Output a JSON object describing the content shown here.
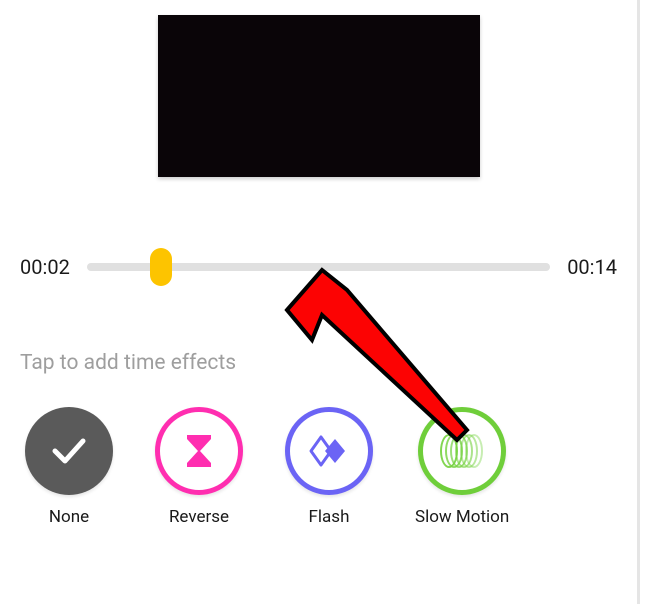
{
  "timeline": {
    "current_time": "00:02",
    "total_time": "00:14",
    "handle_position_percent": 16
  },
  "instruction_text": "Tap to add time effects",
  "effects": {
    "none": {
      "label": "None"
    },
    "reverse": {
      "label": "Reverse"
    },
    "flash": {
      "label": "Flash"
    },
    "slow_motion": {
      "label": "Slow Motion"
    }
  },
  "colors": {
    "accent_yellow": "#fdc400",
    "none_bg": "#5a5a5a",
    "reverse_ring": "#ff2eb0",
    "flash_ring": "#6b64f5",
    "slowmo_ring": "#6fce3a",
    "arrow_red": "#fc0303"
  }
}
